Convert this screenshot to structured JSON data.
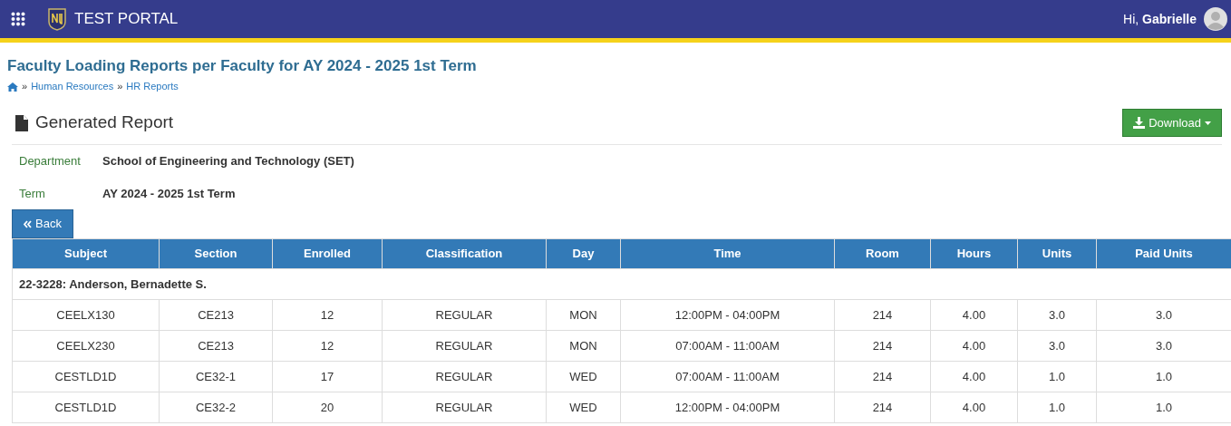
{
  "header": {
    "brand": "TEST PORTAL",
    "greeting": "Hi,",
    "user": "Gabrielle"
  },
  "page_title": "Faculty Loading Reports per Faculty for AY 2024 - 2025 1st Term",
  "breadcrumb": [
    {
      "separator": "»",
      "label": "Human Resources"
    },
    {
      "separator": "»",
      "label": "HR Reports"
    }
  ],
  "panel_title": "Generated Report",
  "download_button": "Download",
  "details": [
    {
      "label": "Department",
      "value": "School of Engineering and Technology (SET)"
    },
    {
      "label": "Term",
      "value": "AY 2024 - 2025 1st Term"
    }
  ],
  "back_button": "Back",
  "table": {
    "columns": [
      "Subject",
      "Section",
      "Enrolled",
      "Classification",
      "Day",
      "Time",
      "Room",
      "Hours",
      "Units",
      "Paid Units"
    ],
    "rows": [
      {
        "kind": "group",
        "label": "22-3228: Anderson, Bernadette S."
      },
      {
        "kind": "data",
        "cells": [
          "CEELX130",
          "CE213",
          "12",
          "REGULAR",
          "MON",
          "12:00PM - 04:00PM",
          "214",
          "4.00",
          "3.0",
          "3.0"
        ]
      },
      {
        "kind": "data",
        "cells": [
          "CEELX230",
          "CE213",
          "12",
          "REGULAR",
          "MON",
          "07:00AM - 11:00AM",
          "214",
          "4.00",
          "3.0",
          "3.0"
        ]
      },
      {
        "kind": "data",
        "cells": [
          "CESTLD1D",
          "CE32-1",
          "17",
          "REGULAR",
          "WED",
          "07:00AM - 11:00AM",
          "214",
          "4.00",
          "1.0",
          "1.0"
        ]
      },
      {
        "kind": "data",
        "cells": [
          "CESTLD1D",
          "CE32-2",
          "20",
          "REGULAR",
          "WED",
          "12:00PM - 04:00PM",
          "214",
          "4.00",
          "1.0",
          "1.0"
        ]
      }
    ]
  }
}
